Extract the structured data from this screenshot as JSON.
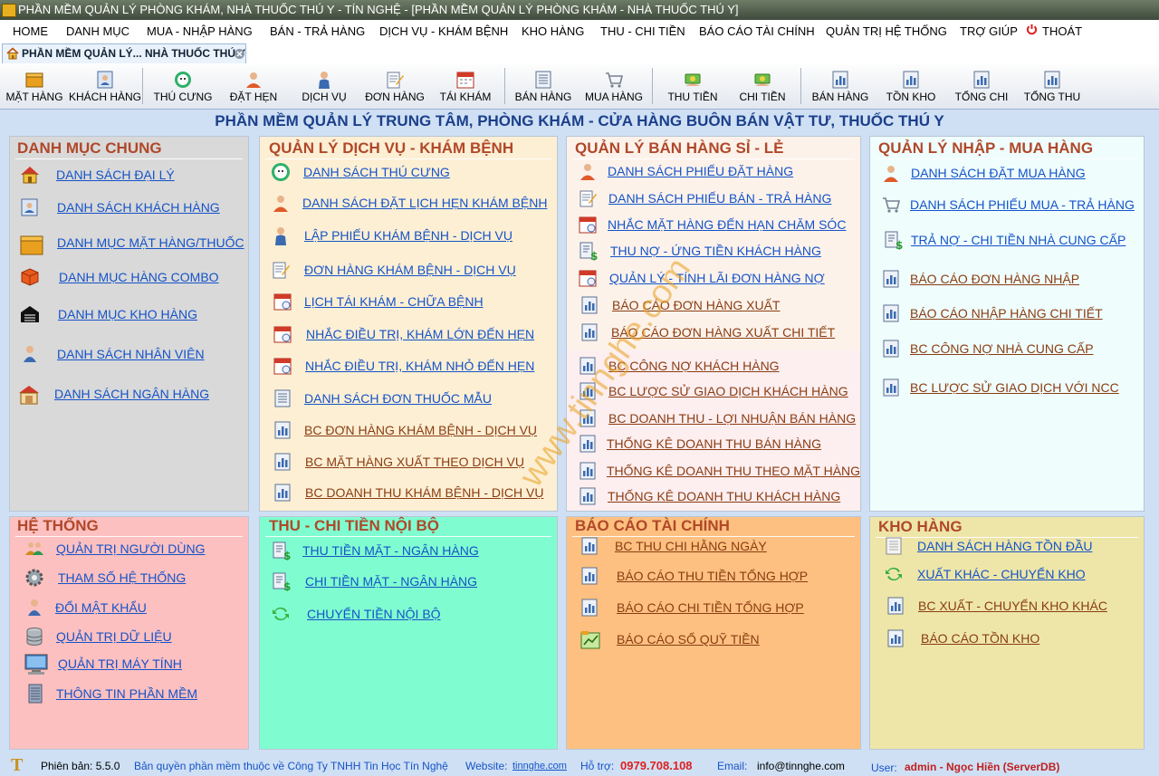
{
  "window": {
    "title": "PHẦN MỀM QUẢN LÝ PHÒNG KHÁM, NHÀ THUỐC THÚ Y - TÍN NGHỆ - [PHẦN MỀM QUẢN LÝ PHÒNG KHÁM - NHÀ THUỐC THÚ Y]"
  },
  "menu": [
    "HOME",
    "DANH MỤC",
    "MUA - NHẬP HÀNG",
    "BÁN - TRẢ HÀNG",
    "DỊCH VỤ - KHÁM BỆNH",
    "KHO HÀNG",
    "THU - CHI TIỀN",
    "BÁO CÁO TÀI CHÍNH",
    "QUẢN TRỊ HỆ THỐNG",
    "TRỢ GIÚP",
    "THOÁT"
  ],
  "tab": {
    "label": "PHẦN MỀM QUẢN LÝ... NHÀ THUỐC THÚ Y"
  },
  "toolbar": [
    "MẶT HÀNG",
    "KHÁCH HÀNG",
    "THÚ CƯNG",
    "ĐẶT HẸN",
    "DỊCH VỤ",
    "ĐƠN HÀNG",
    "TÁI KHÁM",
    "BÁN HÀNG",
    "MUA HÀNG",
    "THU TIỀN",
    "CHI TIỀN",
    "BÁN HÀNG",
    "TỒN KHO",
    "TỔNG CHI",
    "TỔNG THU"
  ],
  "main_title": "PHẦN MỀM QUẢN LÝ TRUNG TÂM, PHÒNG KHÁM - CỬA HÀNG BUÔN BÁN VẬT TƯ, THUỐC THÚ Y",
  "panels": {
    "danh_muc_chung": {
      "title": "DANH MỤC CHUNG",
      "items": [
        "DANH SÁCH ĐẠI LÝ",
        "DANH SÁCH KHÁCH HÀNG",
        "DANH MỤC MẶT HÀNG/THUỐC",
        "DANH MỤC HÀNG COMBO",
        "DANH MỤC KHO HÀNG",
        "DANH SÁCH NHÂN VIÊN",
        "DANH SÁCH NGÂN HÀNG"
      ]
    },
    "dich_vu": {
      "title": "QUẢN LÝ DỊCH VỤ - KHÁM BỆNH",
      "items": [
        "DANH SÁCH THÚ CƯNG",
        "DANH SÁCH ĐẶT LỊCH HẸN KHÁM BỆNH",
        "LẬP PHIẾU KHÁM BỆNH - DỊCH VỤ",
        "ĐƠN HÀNG KHÁM BỆNH - DỊCH VỤ",
        "LỊCH TÁI KHÁM - CHỮA BỆNH",
        "NHẮC ĐIỀU TRỊ, KHÁM LỚN ĐẾN HẸN",
        "NHẮC ĐIỀU TRỊ, KHÁM NHỎ ĐẾN HẸN",
        "DANH SÁCH ĐƠN THUỐC MẪU",
        "BC ĐƠN HÀNG KHÁM BỆNH - DỊCH VỤ",
        "BC MẶT HÀNG XUẤT THEO DỊCH VỤ",
        "BC DOANH THU KHÁM BỆNH - DỊCH VỤ"
      ]
    },
    "ban_hang": {
      "title": "QUẢN LÝ BÁN HÀNG SỈ - LẺ",
      "items": [
        "DANH SÁCH PHIẾU ĐẶT HÀNG",
        "DANH SÁCH PHIẾU BÁN - TRẢ HÀNG",
        "NHẮC MẶT HÀNG ĐẾN HẠN CHĂM SÓC",
        "THU NỢ - ỨNG TIỀN KHÁCH HÀNG",
        "QUẢN LÝ - TÍNH LÃI ĐƠN HÀNG NỢ",
        "BÁO CÁO ĐƠN HÀNG XUẤT",
        "BÁO CÁO ĐƠN HÀNG XUẤT CHI TIẾT",
        "BC CÔNG NỢ KHÁCH HÀNG",
        "BC LƯỢC SỬ GIAO DỊCH KHÁCH HÀNG",
        "BC DOANH THU - LỢI NHUẬN BÁN HÀNG",
        "THỐNG KÊ DOANH THU BÁN HÀNG",
        "THỐNG KÊ DOANH THU THEO MẶT HÀNG",
        "THỐNG KÊ DOANH THU KHÁCH HÀNG"
      ]
    },
    "nhap_hang": {
      "title": "QUẢN LÝ NHẬP - MUA HÀNG",
      "items": [
        "DANH SÁCH ĐẶT MUA HÀNG",
        "DANH SÁCH PHIẾU MUA - TRẢ HÀNG",
        "TRẢ NỢ - CHI TIỀN NHÀ CUNG CẤP",
        "BÁO CÁO ĐƠN HÀNG NHẬP",
        "BÁO CÁO NHẬP HÀNG CHI TIẾT",
        "BC CÔNG NỢ NHÀ CUNG CẤP",
        "BC LƯỢC SỬ GIAO DỊCH VỚI NCC"
      ]
    },
    "he_thong": {
      "title": "HỆ THỐNG",
      "items": [
        "QUẢN TRỊ NGƯỜI DÙNG",
        "THAM SỐ HỆ THỐNG",
        "ĐỔI MẬT KHẨU",
        "QUẢN TRỊ DỮ LIỆU",
        "QUẢN TRỊ MÁY TÍNH",
        "THÔNG TIN PHẦN MỀM"
      ]
    },
    "thu_chi": {
      "title": "THU - CHI TIỀN NỘI BỘ",
      "items": [
        "THU TIỀN MẶT - NGÂN HÀNG",
        "CHI TIỀN MẶT - NGÂN HÀNG",
        "CHUYỂN TIỀN NỘI BỘ"
      ]
    },
    "bao_cao": {
      "title": "BÁO CÁO TÀI CHÍNH",
      "items": [
        "BC THU CHI HẰNG NGÀY",
        "BÁO CÁO THU TIỀN TỔNG HỢP",
        "BÁO CÁO CHI TIỀN TỔNG HỢP",
        "BÁO CÁO SỔ QUỸ TIỀN"
      ]
    },
    "kho_hang": {
      "title": "KHO HÀNG",
      "items": [
        "DANH SÁCH HÀNG TỒN ĐẦU",
        "XUẤT KHÁC - CHUYỂN KHO",
        "BC XUẤT - CHUYỂN KHO KHÁC",
        "BÁO CÁO TỒN KHO"
      ]
    }
  },
  "footer": {
    "version_label": "Phiên bản: 5.5.0",
    "copyright": "Bản quyền phần mềm thuộc về Công Ty TNHH Tin Học Tín Nghệ",
    "website_label": "Website:",
    "website": "tinnghe.com",
    "support_label": "Hỗ trợ:",
    "phone": "0979.708.108",
    "email_label": "Email:",
    "email": "info@tinnghe.com",
    "user_label": "User:",
    "user": "admin - Ngọc Hiền (ServerDB)"
  },
  "watermark": "www.tinnghe.com",
  "colors": {
    "danh_muc_chung": "#d9d9d9",
    "dich_vu": "#fdefd4",
    "ban_hang": "#fdf2ea",
    "nhap_hang": "#effdfd",
    "he_thong": "#fdc0c0",
    "thu_chi": "#80fdd0",
    "bao_cao": "#fdc080",
    "kho_hang": "#eee6a8",
    "title_blue": "#1b3f8b",
    "title_brown": "#b0482a"
  }
}
